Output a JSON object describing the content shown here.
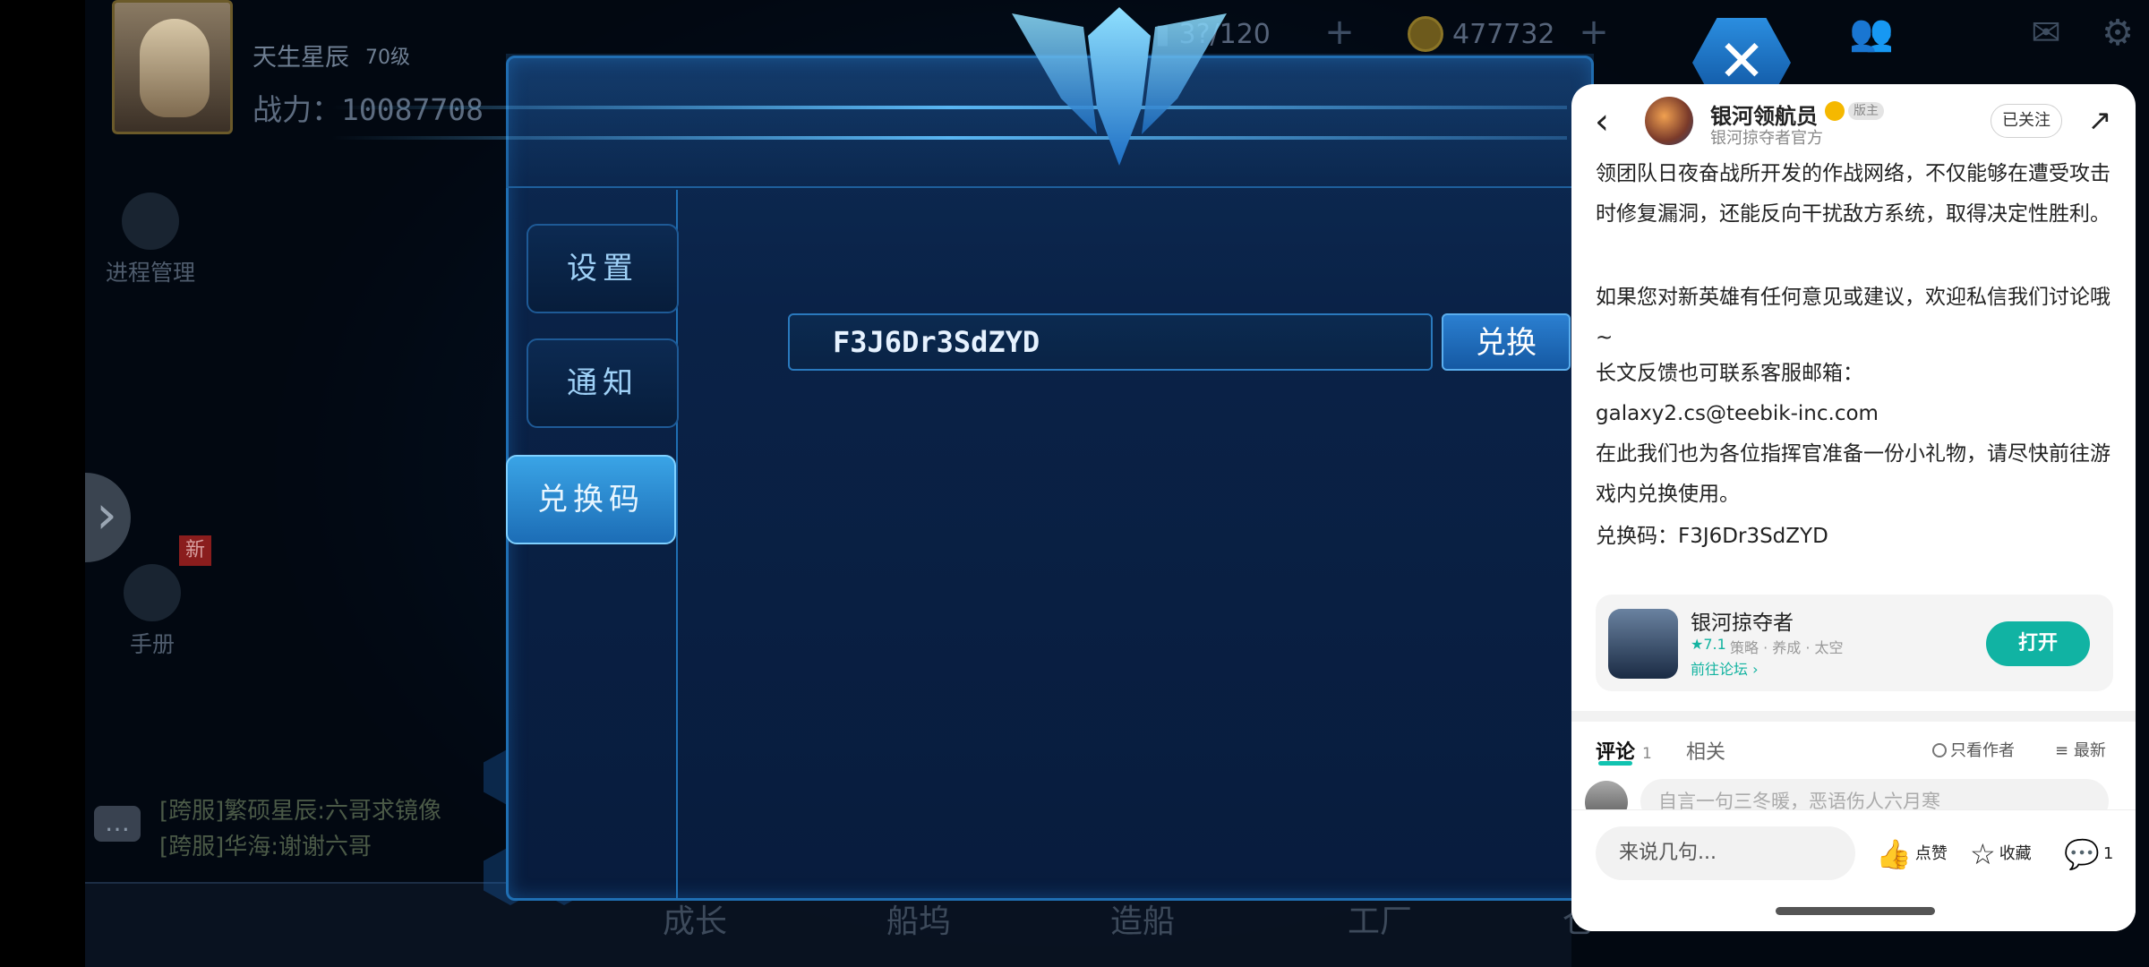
{
  "game": {
    "player_name": "天生星辰",
    "player_level": "70级",
    "power_label": "战力：",
    "power_value": "10087708",
    "res1": "3?/120",
    "res2": "477732",
    "side_btn1": "进程管理",
    "side_btn2": "手册",
    "new_badge": "新",
    "chat1": "[跨服]繁硕星辰:六哥求镜像",
    "chat2": "[跨服]华海:谢谢六哥",
    "bottom_nav": [
      "成长",
      "船坞",
      "造船",
      "工厂",
      "仓"
    ],
    "tabs": [
      "设置",
      "通知",
      "兑换码"
    ],
    "active_tab": "兑换码",
    "code_value": "F3J6Dr3SdZYD",
    "redeem_label": "兑换",
    "close_icon": "✕",
    "accent_color": "#2a79bd"
  },
  "sheet": {
    "author": "银河领航员",
    "author_badge": "版主",
    "author_sub": "银河掠夺者官方",
    "follow_label": "已关注",
    "para1": "领团队日夜奋战所开发的作战网络，不仅能够在遭受攻击时修复漏洞，还能反向干扰敌方系统，取得决定性胜利。",
    "para2": "如果您对新英雄有任何意见或建议，欢迎私信我们讨论哦~",
    "para3": "长文反馈也可联系客服邮箱：",
    "email": "galaxy2.cs@teebik-inc.com",
    "para4": "在此我们也为各位指挥官准备一份小礼物，请尽快前往游戏内兑换使用。",
    "code_line": "兑换码：F3J6Dr3SdZYD",
    "app_name": "银河掠夺者",
    "app_rating": "★7.1",
    "app_tags": "策略 · 养成 · 太空",
    "app_forum": "前往论坛 ›",
    "open_label": "打开",
    "comment_tab": "评论",
    "comment_count": "1",
    "related_tab": "相关",
    "author_only": "只看作者",
    "latest": "最新",
    "comment_placeholder": "自言一句三冬暖，恶语伤人六月寒",
    "say_placeholder": "来说几句...",
    "like_label": "点赞",
    "fav_label": "收藏",
    "reply_count": "1",
    "teal_color": "#11b3a3"
  }
}
